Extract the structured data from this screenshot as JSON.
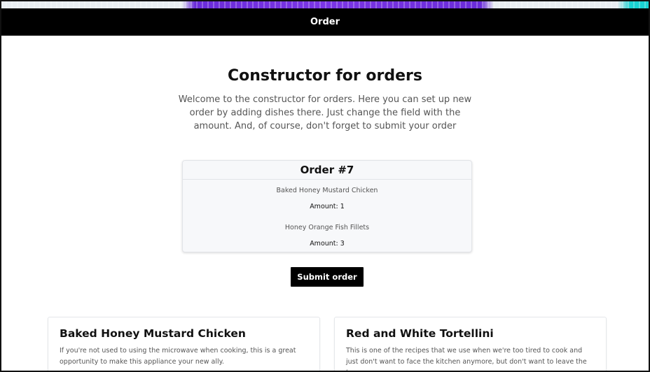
{
  "navbar": {
    "title": "Order"
  },
  "hero": {
    "title": "Constructor for orders",
    "description": "Welcome to the constructor for orders. Here you can set up new order by adding dishes there. Just change the field with the amount. And, of course, don't forget to submit your order"
  },
  "order": {
    "title": "Order #7",
    "items": [
      {
        "dish": "Baked Honey Mustard Chicken",
        "amount": "Amount: 1"
      },
      {
        "dish": "Honey Orange Fish Fillets",
        "amount": "Amount: 3"
      }
    ]
  },
  "submit_label": "Submit order",
  "dishes": [
    {
      "title": "Baked Honey Mustard Chicken",
      "description": "If you're not used to using the microwave when cooking, this is a great opportunity to make this appliance your new ally."
    },
    {
      "title": "Red and White Tortellini",
      "description": "This is one of the recipes that we use when we're too tired to cook and just don't want to face the kitchen anymore, but don't want to leave the house."
    }
  ],
  "colors": {
    "navbar": "#000000",
    "button": "#000000",
    "banner_accent": "#6a2bd9",
    "banner_cyan": "#19d3d3"
  }
}
